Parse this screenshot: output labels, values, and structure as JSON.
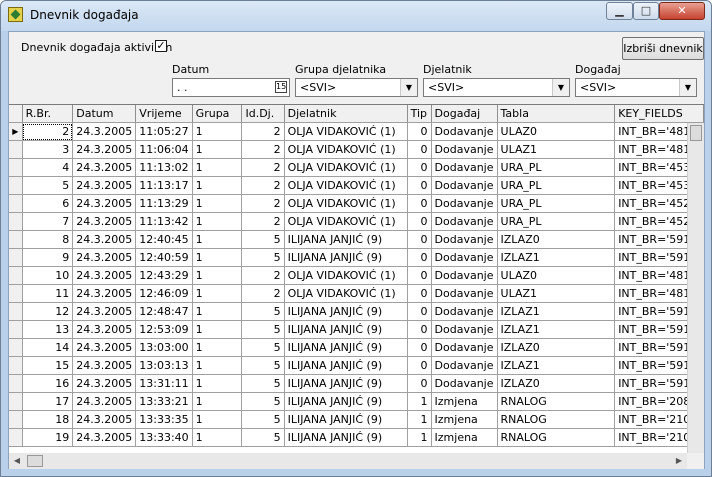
{
  "window": {
    "title": "Dnevnik događaja",
    "app_icon": "app-logo-icon",
    "controls": {
      "minimize": "▁",
      "maximize": "□",
      "close": "✕"
    }
  },
  "filters": {
    "log_active_label": "Dnevnik događaja aktiviran",
    "log_active_checked": "✓",
    "clear_button": "Izbriši dnevnik",
    "date_label": "Datum",
    "date_value": "  .  .",
    "calendar_icon": "15",
    "group_label": "Grupa djelatnika",
    "group_value": "<SVI>",
    "employee_label": "Djelatnik",
    "employee_value": "<SVI>",
    "event_label": "Događaj",
    "event_value": "<SVI>"
  },
  "table": {
    "columns": [
      "R.Br.",
      "Datum",
      "Vrijeme",
      "Grupa",
      "Id.Dj.",
      "Djelatnik",
      "Tip",
      "Događaj",
      "Tabla",
      "KEY_FIELDS"
    ],
    "rows": [
      [
        "2",
        "24.3.2005",
        "11:05:27",
        "1",
        "2",
        "OLJA VIDAKOVIĆ (1)",
        "0",
        "Dodavanje",
        "ULAZ0",
        "INT_BR='481"
      ],
      [
        "3",
        "24.3.2005",
        "11:06:04",
        "1",
        "2",
        "OLJA VIDAKOVIĆ (1)",
        "0",
        "Dodavanje",
        "ULAZ1",
        "INT_BR='481"
      ],
      [
        "4",
        "24.3.2005",
        "11:13:02",
        "1",
        "2",
        "OLJA VIDAKOVIĆ (1)",
        "0",
        "Dodavanje",
        "URA_PL",
        "INT_BR='453"
      ],
      [
        "5",
        "24.3.2005",
        "11:13:17",
        "1",
        "2",
        "OLJA VIDAKOVIĆ (1)",
        "0",
        "Dodavanje",
        "URA_PL",
        "INT_BR='453"
      ],
      [
        "6",
        "24.3.2005",
        "11:13:29",
        "1",
        "2",
        "OLJA VIDAKOVIĆ (1)",
        "0",
        "Dodavanje",
        "URA_PL",
        "INT_BR='452"
      ],
      [
        "7",
        "24.3.2005",
        "11:13:42",
        "1",
        "2",
        "OLJA VIDAKOVIĆ (1)",
        "0",
        "Dodavanje",
        "URA_PL",
        "INT_BR='452"
      ],
      [
        "8",
        "24.3.2005",
        "12:40:45",
        "1",
        "5",
        "ILIJANA JANJIĆ (9)",
        "0",
        "Dodavanje",
        "IZLAZ0",
        "INT_BR='591"
      ],
      [
        "9",
        "24.3.2005",
        "12:40:59",
        "1",
        "5",
        "ILIJANA JANJIĆ (9)",
        "0",
        "Dodavanje",
        "IZLAZ1",
        "INT_BR='591"
      ],
      [
        "10",
        "24.3.2005",
        "12:43:29",
        "1",
        "2",
        "OLJA VIDAKOVIĆ (1)",
        "0",
        "Dodavanje",
        "ULAZ0",
        "INT_BR='481"
      ],
      [
        "11",
        "24.3.2005",
        "12:46:09",
        "1",
        "2",
        "OLJA VIDAKOVIĆ (1)",
        "0",
        "Dodavanje",
        "ULAZ1",
        "INT_BR='481"
      ],
      [
        "12",
        "24.3.2005",
        "12:48:47",
        "1",
        "5",
        "ILIJANA JANJIĆ (9)",
        "0",
        "Dodavanje",
        "IZLAZ1",
        "INT_BR='591"
      ],
      [
        "13",
        "24.3.2005",
        "12:53:09",
        "1",
        "5",
        "ILIJANA JANJIĆ (9)",
        "0",
        "Dodavanje",
        "IZLAZ1",
        "INT_BR='591"
      ],
      [
        "14",
        "24.3.2005",
        "13:03:00",
        "1",
        "5",
        "ILIJANA JANJIĆ (9)",
        "0",
        "Dodavanje",
        "IZLAZ0",
        "INT_BR='591"
      ],
      [
        "15",
        "24.3.2005",
        "13:03:13",
        "1",
        "5",
        "ILIJANA JANJIĆ (9)",
        "0",
        "Dodavanje",
        "IZLAZ1",
        "INT_BR='591"
      ],
      [
        "16",
        "24.3.2005",
        "13:31:11",
        "1",
        "5",
        "ILIJANA JANJIĆ (9)",
        "0",
        "Dodavanje",
        "IZLAZ0",
        "INT_BR='591"
      ],
      [
        "17",
        "24.3.2005",
        "13:33:21",
        "1",
        "5",
        "ILIJANA JANJIĆ (9)",
        "1",
        "Izmjena",
        "RNALOG",
        "INT_BR='208"
      ],
      [
        "18",
        "24.3.2005",
        "13:33:35",
        "1",
        "5",
        "ILIJANA JANJIĆ (9)",
        "1",
        "Izmjena",
        "RNALOG",
        "INT_BR='210"
      ],
      [
        "19",
        "24.3.2005",
        "13:33:40",
        "1",
        "5",
        "ILIJANA JANJIĆ (9)",
        "1",
        "Izmjena",
        "RNALOG",
        "INT_BR='210"
      ]
    ],
    "current_row_marker": "▶"
  }
}
